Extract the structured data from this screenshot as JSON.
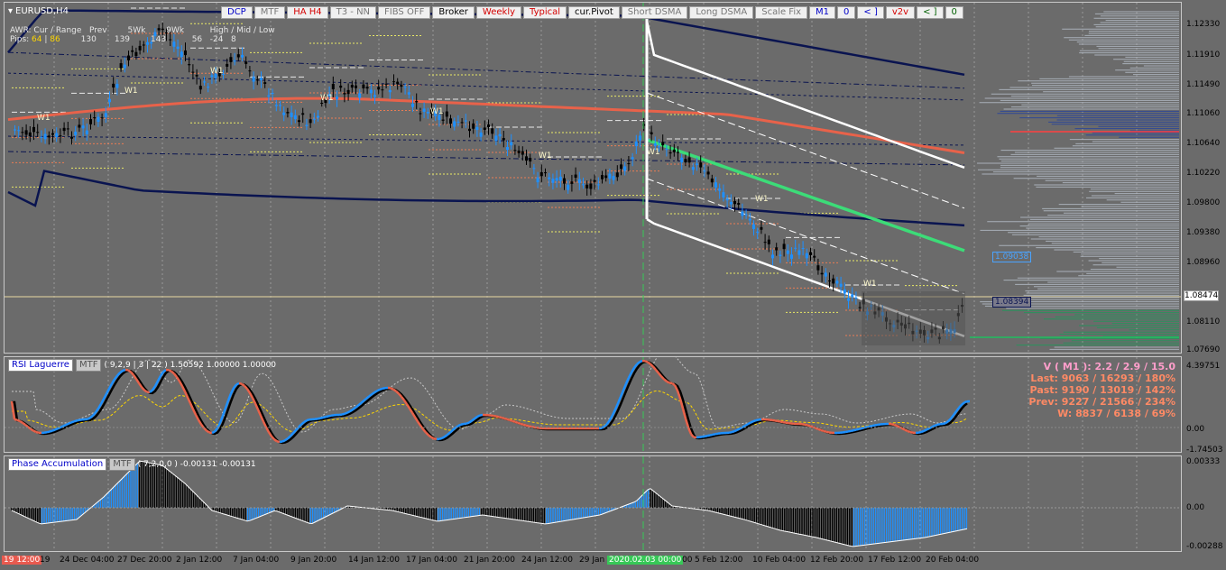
{
  "symbol": "EURUSD,H4",
  "toolbar": [
    {
      "label": "DCP",
      "style": "blue"
    },
    {
      "label": "MTF",
      "style": "gray"
    },
    {
      "label": "HA H4",
      "style": "red"
    },
    {
      "label": "T3 - NN",
      "style": "gray"
    },
    {
      "label": "FIBS OFF",
      "style": "gray"
    },
    {
      "label": "Broker",
      "style": "blk"
    },
    {
      "label": "Weekly",
      "style": "red"
    },
    {
      "label": "Typical",
      "style": "red"
    },
    {
      "label": "cur.Pivot",
      "style": "blk"
    },
    {
      "label": "Short DSMA",
      "style": "gray"
    },
    {
      "label": "Long DSMA",
      "style": "gray"
    },
    {
      "label": "Scale Fix",
      "style": "gray"
    },
    {
      "label": "M1",
      "style": "blue"
    },
    {
      "label": "0",
      "style": "blue"
    },
    {
      "label": "< ]",
      "style": "blue"
    },
    {
      "label": "v2v",
      "style": "red"
    },
    {
      "label": "< ]",
      "style": "green"
    },
    {
      "label": "0",
      "style": "green"
    }
  ],
  "info": {
    "line1_labels": "AWR: Cur / Range   Prev        5Wk        9Wk          High / Mid / Low",
    "line2_prefix": "Pips:",
    "line2_cur": "64",
    "line2_range": "86",
    "line2_rest": "        130       139        143          56   -24   8"
  },
  "price_axis": [
    "1.12330",
    "1.11910",
    "1.11490",
    "1.11060",
    "1.10640",
    "1.10220",
    "1.09800",
    "1.09380",
    "1.08960",
    "1.08474",
    "1.08110",
    "1.07690"
  ],
  "price_badges": {
    "upper": "1.09038",
    "lower": "1.08394"
  },
  "rsi": {
    "name": "RSI Laguerre",
    "mtf": "MTF",
    "params": "( 9,2,9 | 3 | 22 ) 1.50592 1.00000 1.00000",
    "axis": [
      "4.39751",
      "0.00",
      "-1.74503"
    ]
  },
  "stats": {
    "v_line": "V ( M1 ): 2.2 / 2.9 / 15.0",
    "last": "Last: 9063 / 16293 / 180%",
    "past": "Past: 9190 / 13019 / 142%",
    "prev": "Prev: 9227 / 21566 / 234%",
    "w": "W: 8837 / 6138 / 69%"
  },
  "phase": {
    "name": "Phase Accumulation",
    "mtf": "MTF",
    "params": "( 7,2,0,0 ) -0.00131 -0.00131",
    "axis": [
      "0.00333",
      "0.00",
      "-0.00288"
    ]
  },
  "time_axis": [
    {
      "label": "19 12:00",
      "style": "red"
    },
    {
      "label": "19",
      "style": ""
    },
    {
      "label": "24 Dec 04:00",
      "style": ""
    },
    {
      "label": "27 Dec 20:00",
      "style": ""
    },
    {
      "label": "2 Jan 12:00",
      "style": ""
    },
    {
      "label": "7 Jan 04:00",
      "style": ""
    },
    {
      "label": "9 Jan 20:00",
      "style": ""
    },
    {
      "label": "14 Jan 12:00",
      "style": ""
    },
    {
      "label": "17 Jan 04:00",
      "style": ""
    },
    {
      "label": "21 Jan 20:00",
      "style": ""
    },
    {
      "label": "24 Jan 12:00",
      "style": ""
    },
    {
      "label": "29 Jan",
      "style": ""
    },
    {
      "label": "2020.02.03 00:00",
      "style": "green"
    },
    {
      "label": "00",
      "style": ""
    },
    {
      "label": "5 Feb 12:00",
      "style": ""
    },
    {
      "label": "10 Feb 04:00",
      "style": ""
    },
    {
      "label": "12 Feb 20:00",
      "style": ""
    },
    {
      "label": "17 Feb 12:00",
      "style": ""
    },
    {
      "label": "20 Feb 04:00",
      "style": ""
    }
  ],
  "colors": {
    "background": "#6b6b6b",
    "bull_candle": "#1e90ff",
    "bear_candle": "#000000",
    "ma_red": "#e8624a",
    "ma_green": "#3cdc78",
    "band_navy": "#0a1450",
    "band_white": "#ffffff",
    "stats_pink": "#ff9ecb",
    "stats_orange": "#ff8a65"
  }
}
